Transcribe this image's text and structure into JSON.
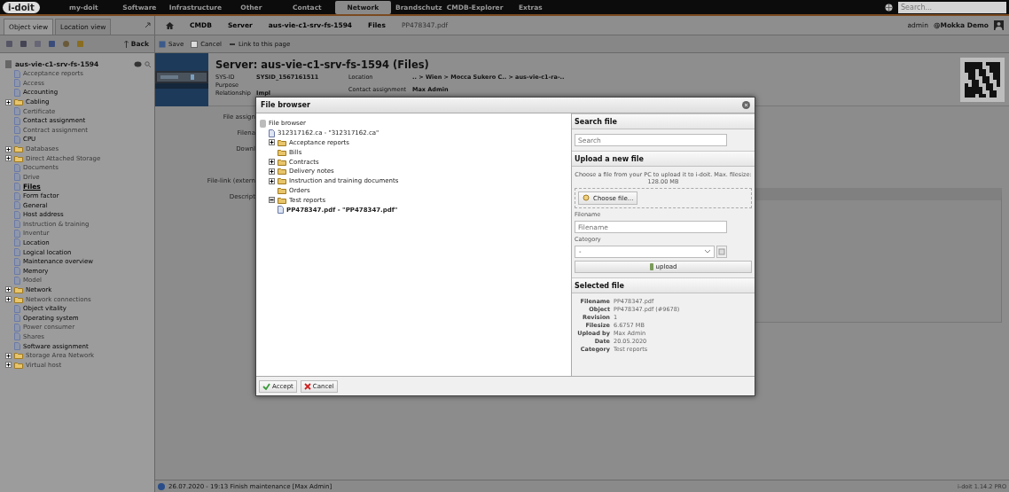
{
  "top_nav": {
    "logo": "i-doit",
    "items": [
      {
        "label": "my-doit",
        "selected": false
      },
      {
        "label": "Software",
        "selected": false
      },
      {
        "label": "Infrastructure",
        "selected": false
      },
      {
        "label": "Other",
        "selected": false
      },
      {
        "label": "Contact",
        "selected": false
      },
      {
        "label": "Network",
        "selected": true
      },
      {
        "label": "Brandschutz",
        "selected": false
      },
      {
        "label": "CMDB-Explorer",
        "selected": false
      },
      {
        "label": "Extras",
        "selected": false
      }
    ],
    "search": {
      "placeholder": "Search..."
    }
  },
  "sidebar": {
    "tabs": [
      {
        "label": "Object view",
        "selected": true
      },
      {
        "label": "Location view",
        "selected": false
      }
    ],
    "back": "Back",
    "object": "aus-vie-c1-srv-fs-1594",
    "items": [
      {
        "label": "Acceptance reports",
        "kind": "file",
        "disabled": true,
        "selected": false
      },
      {
        "label": "Access",
        "kind": "file",
        "disabled": true,
        "selected": false
      },
      {
        "label": "Accounting",
        "kind": "file",
        "disabled": false,
        "selected": false
      },
      {
        "label": "Cabling",
        "kind": "folder",
        "disabled": false,
        "selected": false
      },
      {
        "label": "Certificate",
        "kind": "file",
        "disabled": true,
        "selected": false
      },
      {
        "label": "Contact assignment",
        "kind": "file",
        "disabled": false,
        "selected": false
      },
      {
        "label": "Contract assignment",
        "kind": "file",
        "disabled": true,
        "selected": false
      },
      {
        "label": "CPU",
        "kind": "file",
        "disabled": false,
        "selected": false
      },
      {
        "label": "Databases",
        "kind": "folder",
        "disabled": true,
        "selected": false
      },
      {
        "label": "Direct Attached Storage",
        "kind": "folder",
        "disabled": true,
        "selected": false
      },
      {
        "label": "Documents",
        "kind": "file",
        "disabled": true,
        "selected": false
      },
      {
        "label": "Drive",
        "kind": "file",
        "disabled": true,
        "selected": false
      },
      {
        "label": "Files",
        "kind": "file",
        "disabled": false,
        "selected": true
      },
      {
        "label": "Form factor",
        "kind": "file",
        "disabled": false,
        "selected": false
      },
      {
        "label": "General",
        "kind": "file",
        "disabled": false,
        "selected": false
      },
      {
        "label": "Host address",
        "kind": "file",
        "disabled": false,
        "selected": false
      },
      {
        "label": "Instruction & training",
        "kind": "file",
        "disabled": true,
        "selected": false
      },
      {
        "label": "Inventur",
        "kind": "file",
        "disabled": true,
        "selected": false
      },
      {
        "label": "Location",
        "kind": "file",
        "disabled": false,
        "selected": false
      },
      {
        "label": "Logical location",
        "kind": "file",
        "disabled": false,
        "selected": false
      },
      {
        "label": "Maintenance overview",
        "kind": "file",
        "disabled": false,
        "selected": false
      },
      {
        "label": "Memory",
        "kind": "file",
        "disabled": false,
        "selected": false
      },
      {
        "label": "Model",
        "kind": "file",
        "disabled": true,
        "selected": false
      },
      {
        "label": "Network",
        "kind": "folder",
        "disabled": false,
        "selected": false
      },
      {
        "label": "Network connections",
        "kind": "folder",
        "disabled": true,
        "selected": false
      },
      {
        "label": "Object vitality",
        "kind": "file",
        "disabled": false,
        "selected": false
      },
      {
        "label": "Operating system",
        "kind": "file",
        "disabled": false,
        "selected": false
      },
      {
        "label": "Power consumer",
        "kind": "file",
        "disabled": true,
        "selected": false
      },
      {
        "label": "Shares",
        "kind": "file",
        "disabled": true,
        "selected": false
      },
      {
        "label": "Software assignment",
        "kind": "file",
        "disabled": false,
        "selected": false
      },
      {
        "label": "Storage Area Network",
        "kind": "folder",
        "disabled": true,
        "selected": false
      },
      {
        "label": "Virtual host",
        "kind": "folder",
        "disabled": true,
        "selected": false
      }
    ]
  },
  "breadcrumb": [
    {
      "label": "CMDB",
      "current": false
    },
    {
      "label": "Server",
      "current": false
    },
    {
      "label": "aus-vie-c1-srv-fs-1594",
      "current": false
    },
    {
      "label": "Files",
      "current": false
    },
    {
      "label": "PP478347.pdf",
      "current": true
    }
  ],
  "user": {
    "name": "admin",
    "tenant": "@Mokka Demo"
  },
  "actions": [
    "Save",
    "Cancel",
    "Link to this page"
  ],
  "header": {
    "title": "Server: aus-vie-c1-srv-fs-1594 (Files)",
    "fields_left": [
      {
        "label": "SYS-ID",
        "value": "SYSID_1567161511"
      },
      {
        "label": "Purpose"
      },
      {
        "label": "Relationship",
        "value": "Impl"
      }
    ],
    "fields_right": [
      {
        "label": "Location",
        "value": ".. > Wien > Mocca Sukero C.. > aus-vie-c1-ra-.."
      },
      {
        "label": "Contact assignment",
        "value": "Max Admin"
      }
    ]
  },
  "form_labels": [
    "File assign",
    "Filena",
    "Downl",
    "File-link (extern",
    "Descript"
  ],
  "dialog": {
    "title": "File browser",
    "tree": {
      "label": "File browser",
      "children": [
        {
          "label": "312317162.ca - \"312317162.ca\"",
          "kind": "file",
          "selected": false
        },
        {
          "label": "Acceptance reports",
          "kind": "folder",
          "expanded": false,
          "selected": false
        },
        {
          "label": "Bills",
          "kind": "folder",
          "selected": false
        },
        {
          "label": "Contracts",
          "kind": "folder",
          "expanded": false,
          "selected": false
        },
        {
          "label": "Delivery notes",
          "kind": "folder",
          "expanded": false,
          "selected": false
        },
        {
          "label": "Instruction and training documents",
          "kind": "folder",
          "expanded": false,
          "selected": false
        },
        {
          "label": "Orders",
          "kind": "folder",
          "selected": false
        },
        {
          "label": "Test reports",
          "kind": "folder",
          "expanded": true,
          "selected": false,
          "children": [
            {
              "label": "PP478347.pdf - \"PP478347.pdf\"",
              "kind": "file",
              "selected": true
            }
          ]
        }
      ]
    },
    "search": {
      "heading": "Search file",
      "placeholder": "Search"
    },
    "upload": {
      "heading": "Upload a new file",
      "hint": "Choose a file from your PC to upload it to i-doit. Max. filesize: 128.00 MB",
      "choose": "Choose file...",
      "filename_label": "Filename",
      "filename_placeholder": "Filename",
      "category_label": "Category",
      "category_value": "-",
      "button": "upload"
    },
    "selected": {
      "heading": "Selected file",
      "rows": [
        {
          "label": "Filename",
          "value": "PP478347.pdf"
        },
        {
          "label": "Object",
          "value": "PP478347.pdf (#9678)"
        },
        {
          "label": "Revision",
          "value": "1"
        },
        {
          "label": "Filesize",
          "value": "6.6757 MB"
        },
        {
          "label": "Upload by",
          "value": "Max Admin"
        },
        {
          "label": "Date",
          "value": "20.05.2020"
        },
        {
          "label": "Category",
          "value": "Test reports"
        }
      ]
    },
    "buttons": [
      {
        "label": "Accept",
        "kind": "accept"
      },
      {
        "label": "Cancel",
        "kind": "cancel"
      }
    ]
  },
  "status_bar": {
    "message": "26.07.2020 - 19:13 Finish maintenance [Max Admin]",
    "version": "i-doit 1.14.2 PRO"
  }
}
